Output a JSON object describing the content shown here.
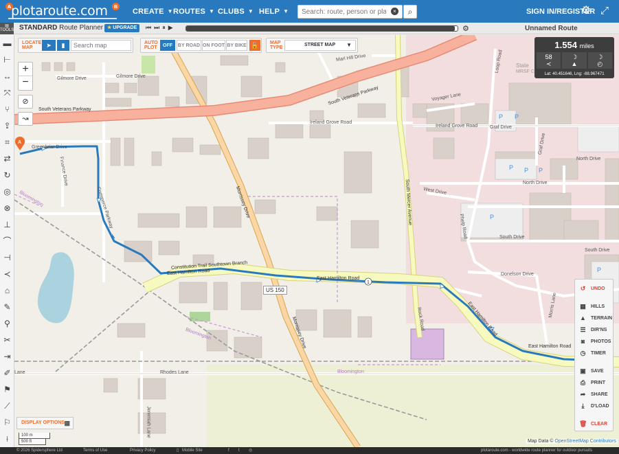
{
  "header": {
    "logo": "plotaroute.com",
    "menu": [
      {
        "label": "CREATE"
      },
      {
        "label": "ROUTES"
      },
      {
        "label": "CLUBS"
      },
      {
        "label": "HELP"
      }
    ],
    "search_placeholder": "Search: route, person or place",
    "signin": "SIGN IN/REGISTER"
  },
  "toolbar": {
    "tools_label": "TOOLS",
    "planner_mode": "STANDARD",
    "planner_label": "Route Planner",
    "upgrade": "UPGRADE",
    "route_name": "Unnamed Route",
    "playback_progress": 0.99
  },
  "locate": {
    "title": "LOCATE MAP",
    "placeholder": "Search map"
  },
  "autoplot": {
    "title": "AUTO PLOT",
    "options": [
      "OFF",
      "BY ROAD",
      "ON FOOT",
      "BY BIKE"
    ],
    "selected": "OFF"
  },
  "maptype": {
    "title": "MAP TYPE",
    "value": "STREET MAP"
  },
  "stats": {
    "distance": "1.554",
    "unit": "miles",
    "points": "58",
    "latlng": "Lat: 40.451646, Lng: -88.967471"
  },
  "actions": [
    {
      "label": "UNDO",
      "icon": "undo-icon",
      "red": true
    },
    {
      "label": "HILLS",
      "icon": "hills-icon"
    },
    {
      "label": "TERRAIN",
      "icon": "terrain-icon"
    },
    {
      "label": "DIR'NS",
      "icon": "list-icon"
    },
    {
      "label": "PHOTOS",
      "icon": "camera-icon"
    },
    {
      "label": "TIMER",
      "icon": "timer-icon"
    },
    {
      "label": "SAVE",
      "icon": "save-icon"
    },
    {
      "label": "PRINT",
      "icon": "print-icon"
    },
    {
      "label": "SHARE",
      "icon": "share-icon"
    },
    {
      "label": "D'LOAD",
      "icon": "download-icon"
    },
    {
      "label": "CLEAR",
      "icon": "trash-icon",
      "red": true
    }
  ],
  "map": {
    "labels": {
      "gilmore1": "Gilmore Drive",
      "gilmore2": "Gilmore Drive",
      "svp_w": "South Veterans Parkway",
      "svp_e": "South Veterans Parkway",
      "marl": "Marl Hill Drive",
      "voyager": "Voyager Lane",
      "ireland1": "Ireland Grove Road",
      "ireland2": "Ireland Grove Road",
      "graf": "Graf Drive",
      "graf2": "Graf Drive",
      "north": "North Drive",
      "north2": "North Drive",
      "west": "West Drive",
      "south": "South Drive",
      "south2": "South Drive",
      "donelson": "Donelson Drive",
      "greenbriar": "Greenbriar Drive",
      "finance": "Finance Drive",
      "commerce": "Commerce Parkway",
      "morrissey": "Morrissey Drive",
      "morrissey2": "Morrissey Drive",
      "mercer": "South Mercer Avenue",
      "constitution": "Constitution Trail Southtown Branch",
      "ehr1": "East Hamilton Road",
      "ehr2": "East Hamilton Road",
      "ehr3": "East Hamilton Road",
      "ehr4": "East Hamilton Road",
      "us150": "US 150",
      "rhodes": "Rhodes Lane",
      "jeremiah": "Jeremiah Lane",
      "bloomington1": "Bloomington",
      "bloomington2": "Bloomington",
      "bloomington3": "Bloomington",
      "state": "State",
      "mrsf": "MRSF C",
      "loop": "Loop Road",
      "phelp": "Phelp Road",
      "rock": "Rock Road",
      "morris": "Morris Lane",
      "lane_w": "Lane"
    }
  },
  "display_options": "DISPLAY OPTIONS",
  "scale": {
    "metric": "100 m",
    "imperial": "500 ft"
  },
  "attribution": {
    "prefix": "Map Data ©",
    "link": "OpenStreetMap Contributors"
  },
  "footer": {
    "copyright": "© 2026 Spidersphere Ltd",
    "terms": "Terms of Use",
    "privacy": "Privacy Policy",
    "mobile": "Mobile Site",
    "tagline": "plotaroute.com - worldwide route planner for outdoor pursuits"
  }
}
